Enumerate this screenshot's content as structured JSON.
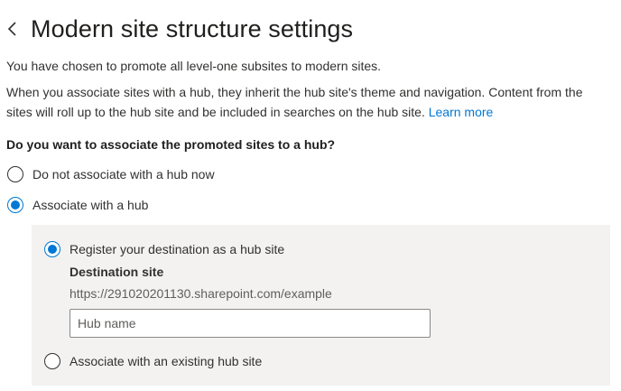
{
  "header": {
    "back_icon": "chevron-left-icon",
    "title": "Modern site structure settings"
  },
  "intro": {
    "promoted_text": "You have chosen to promote all level-one subsites to modern sites.",
    "hub_explanation": "When you associate sites with a hub, they inherit the hub site's theme and navigation.  Content from the sites will roll up to the hub site and be included in searches on the hub site. ",
    "learn_more": "Learn more"
  },
  "hub_question": {
    "label": "Do you want to associate the promoted sites to a hub?",
    "options": [
      {
        "label": "Do not associate with a hub now",
        "selected": false
      },
      {
        "label": "Associate with a hub",
        "selected": true
      }
    ]
  },
  "hub_panel": {
    "options": [
      {
        "label": "Register your destination as a hub site",
        "selected": true
      },
      {
        "label": "Associate with an existing hub site",
        "selected": false
      }
    ],
    "destination_label": "Destination site",
    "destination_url": "https://291020201130.sharepoint.com/example",
    "hub_name_value": "",
    "hub_name_placeholder": "Hub name"
  },
  "colors": {
    "accent": "#0078d4",
    "panel_bg": "#f3f2f1",
    "text": "#323130"
  }
}
